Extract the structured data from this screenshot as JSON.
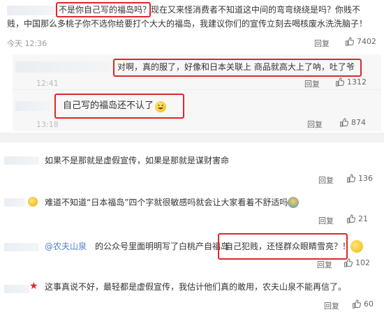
{
  "top": {
    "comment": {
      "quote": "不是你自己写的福岛吗？",
      "line1_rest": "现在又来怪消费者不知道这中间的弯弯绕绕是吗？你贱不",
      "line2": "贱，中国那么多桃子你不选你给要打个大大的福岛，我建议你们的宣传立刻去喝核废水洗洗脑子！",
      "time": "今天 12:36",
      "reply_label": "回复",
      "likes": "7402"
    },
    "reply1": {
      "text": "对啊，真的服了，好像和日本关联上 商品就高大上了呐，吐了爷",
      "time": "12:41",
      "reply_label": "回复",
      "likes": "1312"
    },
    "reply2": {
      "text": "自己写的福岛还不认了",
      "time": "13:18",
      "reply_label": "回复",
      "likes": "874"
    }
  },
  "bottom": {
    "c1": {
      "text": "如果不是那就是虚假宣传，如果是那就是谋财害命",
      "reply_label": "回复",
      "likes": "136"
    },
    "c2": {
      "text": "难道不知道“日本福岛”四个字就很敏感吗就会让大家看着不舒适吗",
      "reply_label": "回复",
      "likes": "21"
    },
    "c3": {
      "mention": "@农夫山泉",
      "text": "的公众号里面明明写了白桃产自福岛",
      "quote": "自己犯贱，还怪群众眼睛雪亮？！",
      "reply_label": "回复",
      "likes": "102"
    },
    "c4": {
      "text": "这事真说不好，最轻都是虚假宣传，我估计他们真的敢用，农夫山泉不能再信了。",
      "reply_label": "回复",
      "likes": "60"
    }
  },
  "colors": {
    "highlight": "#e0262a",
    "link": "#4c7ec7",
    "reply_bg": "#f7f7f7"
  },
  "icons": [
    "thumb-up-icon",
    "grin-emoji",
    "thinking-emoji",
    "star-badge-icon"
  ]
}
